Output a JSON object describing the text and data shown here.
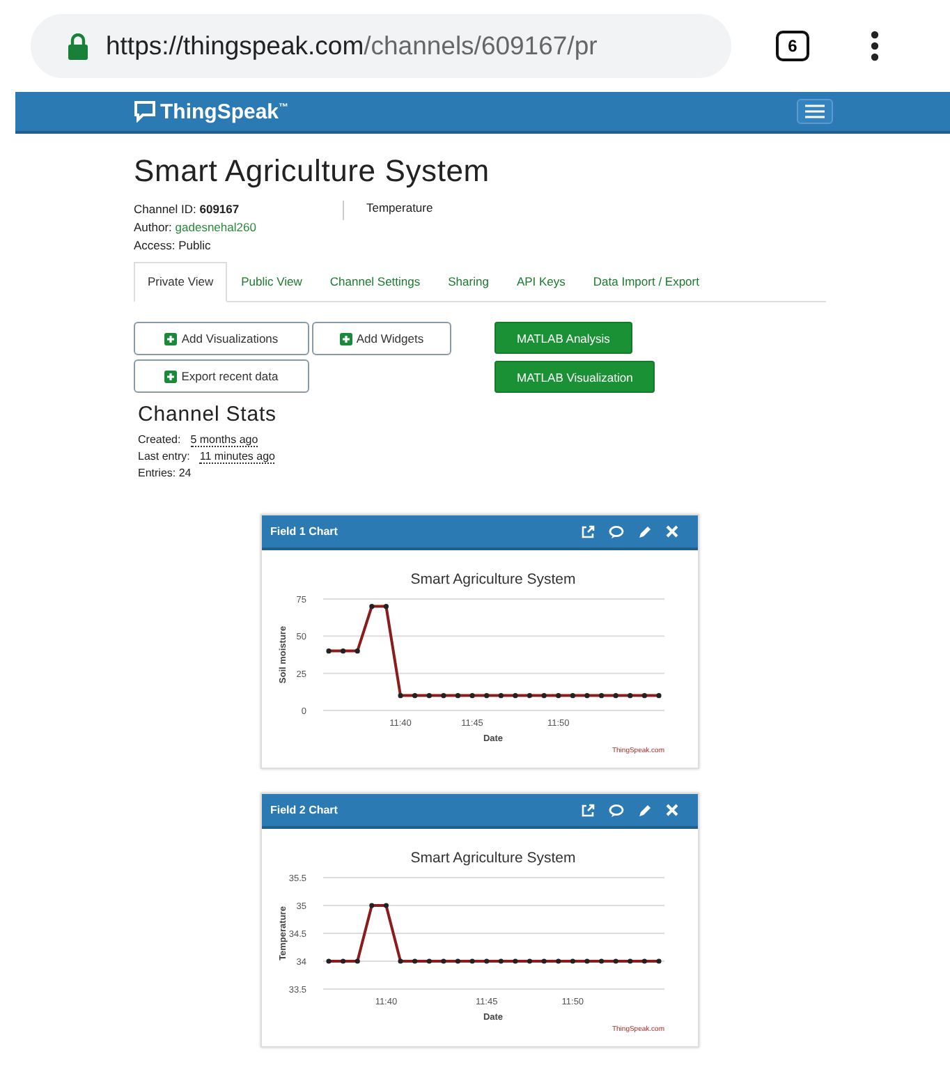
{
  "browser": {
    "url_host": "https://thingspeak.com",
    "url_path": "/channels/609167/pr",
    "tab_count": "6"
  },
  "navbar": {
    "brand": "ThingSpeak",
    "trademark": "™"
  },
  "channel": {
    "title": "Smart Agriculture System",
    "description": "Temperature",
    "fields": [
      {
        "label": "Channel ID:",
        "value": "609167",
        "kind": "bold"
      },
      {
        "label": "Author:",
        "value": "gadesnehal260",
        "kind": "link"
      },
      {
        "label": "Access:",
        "value": "Public",
        "kind": "plain"
      }
    ]
  },
  "tabs": [
    {
      "label": "Private View",
      "selected": true
    },
    {
      "label": "Public View",
      "selected": false
    },
    {
      "label": "Channel Settings",
      "selected": false
    },
    {
      "label": "Sharing",
      "selected": false
    },
    {
      "label": "API Keys",
      "selected": false
    },
    {
      "label": "Data Import / Export",
      "selected": false
    }
  ],
  "actions": [
    {
      "label": "Add Visualizations",
      "kind": "outline"
    },
    {
      "label": "Add Widgets",
      "kind": "outline"
    },
    {
      "label": "MATLAB Analysis",
      "kind": "primary"
    },
    {
      "label": "Export recent data",
      "kind": "outline"
    },
    {
      "label": "MATLAB Visualization",
      "kind": "primary"
    }
  ],
  "stats": {
    "title": "Channel Stats",
    "items": [
      {
        "label": "Created:",
        "value": "5 months ago",
        "kind": "time"
      },
      {
        "label": "Last entry:",
        "value": "11 minutes ago",
        "kind": "time"
      },
      {
        "label": "Entries: 24",
        "kind": "plain"
      }
    ]
  },
  "charts": [
    {
      "title": "Field 1 Chart",
      "credit": "ThingSpeak.com",
      "chart_data": {
        "type": "line",
        "title": "Smart Agriculture System",
        "xlabel": "Date",
        "ylabel": "Soil moisture",
        "grid": true,
        "ylim": [
          0,
          75
        ],
        "yticks": [
          0,
          25,
          50,
          75
        ],
        "categories": [
          null,
          null,
          null,
          null,
          null,
          "11:40",
          null,
          null,
          null,
          null,
          "11:45",
          null,
          null,
          null,
          null,
          null,
          "11:50",
          null,
          null,
          null,
          null,
          null,
          null,
          null
        ],
        "series": [
          {
            "color": "#8b1c1c",
            "marker": true,
            "values": [
              40,
              40,
              40,
              70,
              70,
              10,
              10,
              10,
              10,
              10,
              10,
              10,
              10,
              10,
              10,
              10,
              10,
              10,
              10,
              10,
              10,
              10,
              10,
              10
            ]
          }
        ]
      }
    },
    {
      "title": "Field 2 Chart",
      "credit": "ThingSpeak.com",
      "chart_data": {
        "type": "line",
        "title": "Smart Agriculture System",
        "xlabel": "Date",
        "ylabel": "Temperature",
        "grid": true,
        "ylim": [
          33.5,
          35.5
        ],
        "yticks": [
          33.5,
          34,
          34.5,
          35,
          35.5
        ],
        "categories": [
          null,
          null,
          null,
          null,
          "11:40",
          null,
          null,
          null,
          null,
          null,
          null,
          "11:45",
          null,
          null,
          null,
          null,
          null,
          "11:50",
          null,
          null,
          null,
          null,
          null,
          null
        ],
        "series": [
          {
            "color": "#8b1c1c",
            "marker": true,
            "values": [
              34,
              34,
              34,
              35,
              35,
              34,
              34,
              34,
              34,
              34,
              34,
              34,
              34,
              34,
              34,
              34,
              34,
              34,
              34,
              34,
              34,
              34,
              34,
              34
            ]
          }
        ]
      }
    }
  ]
}
